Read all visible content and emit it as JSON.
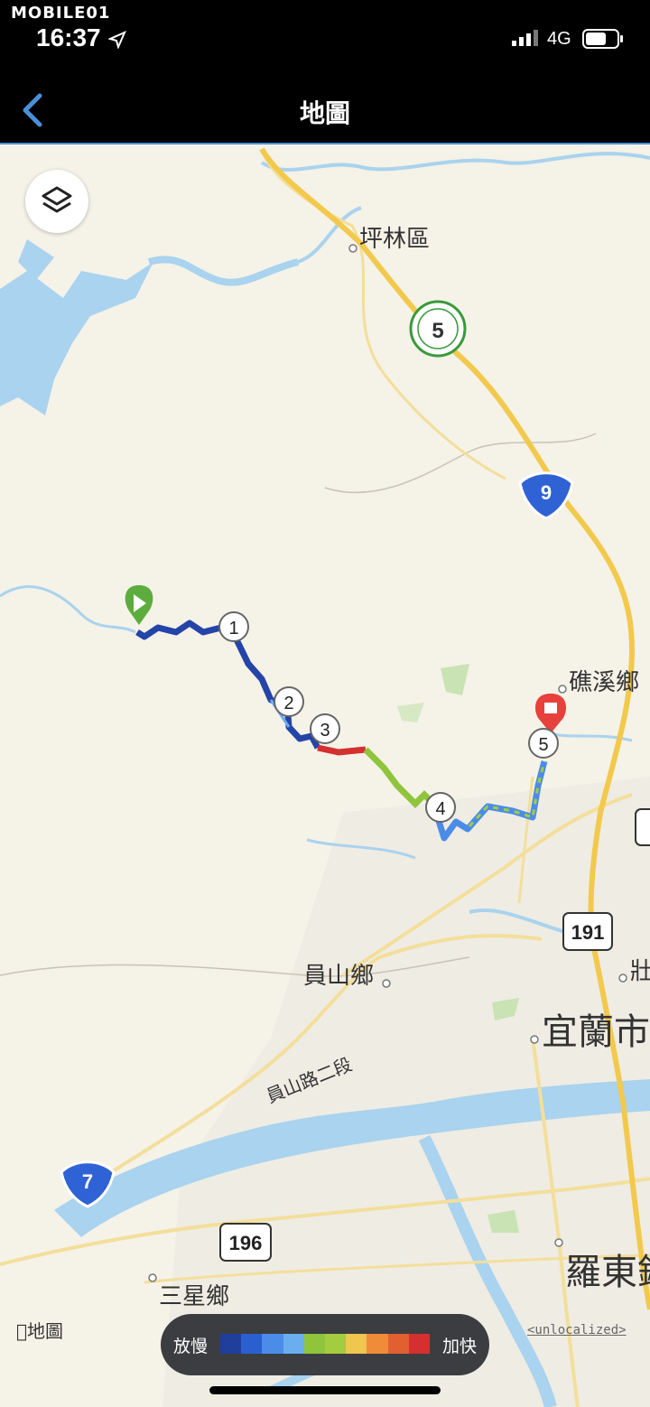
{
  "status_bar": {
    "brand": "MOBILE01",
    "time": "16:37",
    "network": "4G"
  },
  "nav": {
    "title": "地圖",
    "back_label": "Back"
  },
  "map": {
    "places": [
      "坪林區",
      "礁溪鄉",
      "員山鄉",
      "宜蘭市",
      "羅東鎮",
      "三星鄉",
      "壯"
    ],
    "roads": [
      "員山路二段"
    ],
    "highway_shields": [
      "5",
      "9",
      "191",
      "7",
      "196"
    ],
    "route_markers": [
      "1",
      "2",
      "3",
      "4",
      "5"
    ],
    "attribution": "地圖",
    "unlocalized": "<unlocalized>"
  },
  "legend": {
    "slow": "放慢",
    "fast": "加快",
    "colors": [
      "#1f3f9a",
      "#2b5fd0",
      "#4b8ce8",
      "#6aaef0",
      "#8fc43c",
      "#a3cc3e",
      "#f0c550",
      "#f08b3a",
      "#e06030",
      "#d43030"
    ]
  }
}
